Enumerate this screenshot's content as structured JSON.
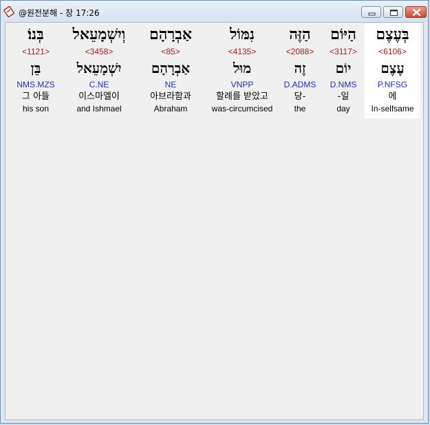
{
  "window": {
    "title": "@원전분해 - 창 17:26"
  },
  "words": [
    {
      "hebrew": "בְּעֶצֶם",
      "strong": "<6106>",
      "hebrew_root": "עֶצֶם",
      "morph": "P.NFSG",
      "korean": "에",
      "english": "In-selfsame",
      "selected": true
    },
    {
      "hebrew": "הַיּוֹם",
      "strong": "<3117>",
      "hebrew_root": "יוֹם",
      "morph": "D.NMS",
      "korean": "-일",
      "english": "day",
      "selected": false
    },
    {
      "hebrew": "הַזֶּה",
      "strong": "<2088>",
      "hebrew_root": "זֶה",
      "morph": "D.ADMS",
      "korean": "당-",
      "english": "the",
      "selected": false
    },
    {
      "hebrew": "נִמּוֹל",
      "strong": "<4135>",
      "hebrew_root": "מוּל",
      "morph": "VNPP",
      "korean": "할례를 받았고",
      "english": "was-circumcised",
      "selected": false
    },
    {
      "hebrew": "אַבְרָהָם",
      "strong": "<85>",
      "hebrew_root": "אַבְרָהָם",
      "morph": "NE",
      "korean": "아브라함과",
      "english": "Abraham",
      "selected": false
    },
    {
      "hebrew": "וְיִשְׁמָעֵאל",
      "strong": "<3458>",
      "hebrew_root": "יִשְׁמָעֵאל",
      "morph": "C.NE",
      "korean": "이스마엘이",
      "english": "and Ishmael",
      "selected": false
    },
    {
      "hebrew": "בְּנוֹ׃",
      "strong": "<1121>",
      "hebrew_root": "בֵּן",
      "morph": "NMS.MZS",
      "korean": "그 아들",
      "english": "his son",
      "selected": false
    }
  ]
}
